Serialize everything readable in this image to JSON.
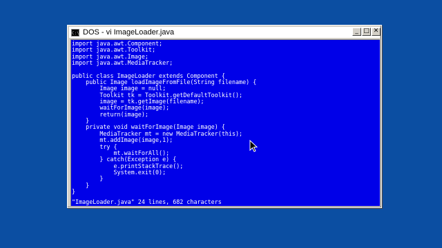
{
  "window": {
    "title": "DOS - vi ImageLoader.java",
    "icon": "C:\\",
    "minimize_label": "_",
    "maximize_label": "□",
    "close_label": "✕"
  },
  "editor": {
    "lines": [
      "import java.awt.Component;",
      "import java.awt.Toolkit;",
      "import java.awt.Image;",
      "import java.awt.MediaTracker;",
      "",
      "public class ImageLoader extends Component {",
      "    public Image loadImageFromFile(String filename) {",
      "        Image image = null;",
      "        Toolkit tk = Toolkit.getDefaultToolkit();",
      "        image = tk.getImage(filename);",
      "        waitForImage(image);",
      "        return(image);",
      "    }",
      "    private void waitForImage(Image image) {",
      "        MediaTracker mt = new MediaTracker(this);",
      "        mt.addImage(image,1);",
      "        try {",
      "            mt.waitForAll();",
      "        } catch(Exception e) {",
      "            e.printStackTrace();",
      "            System.exit(0);",
      "        }",
      "    }",
      "}"
    ],
    "status": "\"ImageLoader.java\" 24 lines, 682 characters"
  },
  "colors": {
    "desktop": "#0b4ea2",
    "console_bg": "#0000e8",
    "console_text": "#ffffff"
  },
  "icons": {
    "window_icon": "dos-prompt-icon",
    "pointer": "mouse-pointer-icon"
  }
}
